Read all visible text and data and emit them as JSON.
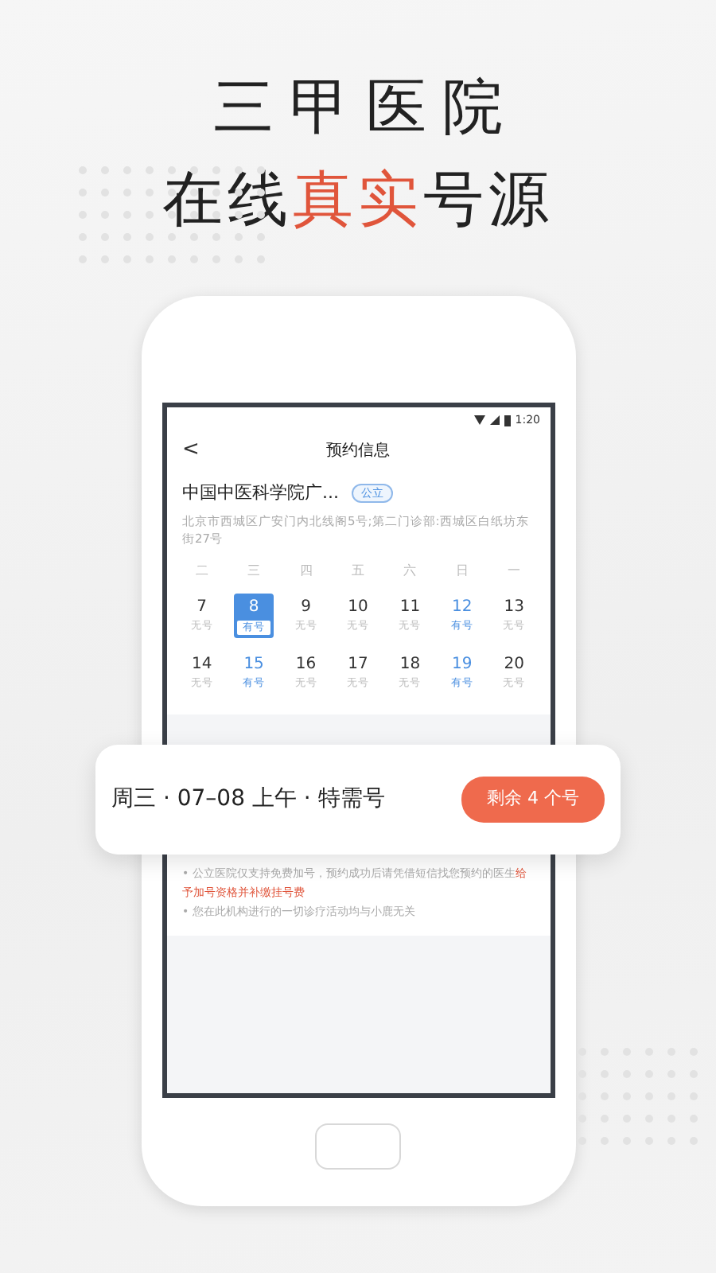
{
  "headline": {
    "line_1": "三甲医院",
    "line_2_parts": [
      {
        "text": "在线",
        "accent": false
      },
      {
        "text": "真实",
        "accent": true
      },
      {
        "text": "号源",
        "accent": false
      }
    ]
  },
  "status_bar": {
    "time": "1:20"
  },
  "header": {
    "back": "<",
    "title": "预约信息"
  },
  "hospital": {
    "name": "中国中医科学院广...",
    "tag": "公立",
    "address": "北京市西城区广安门内北线阁5号;第二门诊部:西城区白纸坊东街27号"
  },
  "weekdays": [
    "二",
    "三",
    "四",
    "五",
    "六",
    "日",
    "一"
  ],
  "weeks": [
    [
      {
        "day": "7",
        "status": "无号",
        "available": false,
        "selected": false
      },
      {
        "day": "8",
        "status": "有号",
        "available": true,
        "selected": true
      },
      {
        "day": "9",
        "status": "无号",
        "available": false,
        "selected": false
      },
      {
        "day": "10",
        "status": "无号",
        "available": false,
        "selected": false
      },
      {
        "day": "11",
        "status": "无号",
        "available": false,
        "selected": false
      },
      {
        "day": "12",
        "status": "有号",
        "available": true,
        "selected": false
      },
      {
        "day": "13",
        "status": "无号",
        "available": false,
        "selected": false
      }
    ],
    [
      {
        "day": "14",
        "status": "无号",
        "available": false,
        "selected": false
      },
      {
        "day": "15",
        "status": "有号",
        "available": true,
        "selected": false
      },
      {
        "day": "16",
        "status": "无号",
        "available": false,
        "selected": false
      },
      {
        "day": "17",
        "status": "无号",
        "available": false,
        "selected": false
      },
      {
        "day": "18",
        "status": "无号",
        "available": false,
        "selected": false
      },
      {
        "day": "19",
        "status": "有号",
        "available": true,
        "selected": false
      },
      {
        "day": "20",
        "status": "无号",
        "available": false,
        "selected": false
      }
    ]
  ],
  "slot_card": {
    "label": "周三 · 07–08 上午 · 特需号",
    "button": "剩余 4 个号"
  },
  "notes": [
    {
      "text": "• 公立医院仅支持免费加号，预约成功后请凭借短信找您预约的医生",
      "highlight": "给予加号资格并补缴挂号费"
    },
    {
      "text": "• 您在此机构进行的一切诊疗活动均与小鹿无关"
    }
  ]
}
